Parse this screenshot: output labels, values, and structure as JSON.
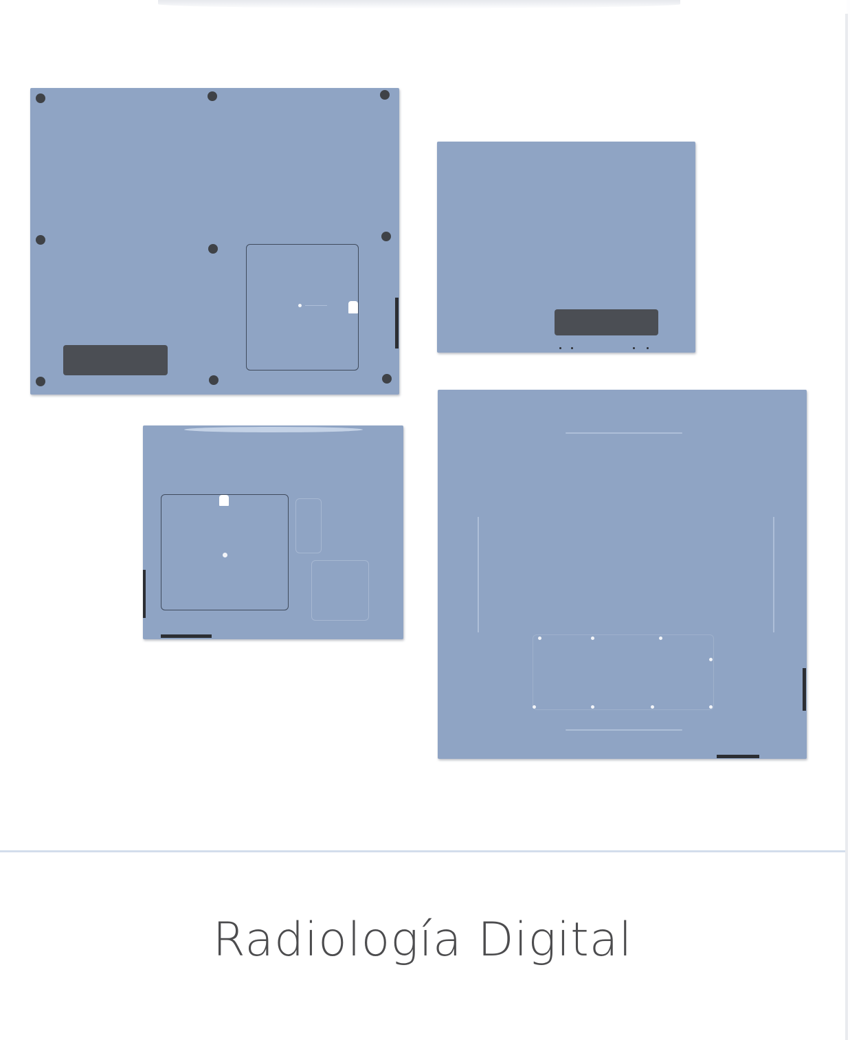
{
  "product": {
    "image_alt": "",
    "caption": "Radiología Digital"
  },
  "colors": {
    "panel": "#8fa4c4",
    "divider": "#d3ddec",
    "caption_text": "#4c4c4e"
  }
}
